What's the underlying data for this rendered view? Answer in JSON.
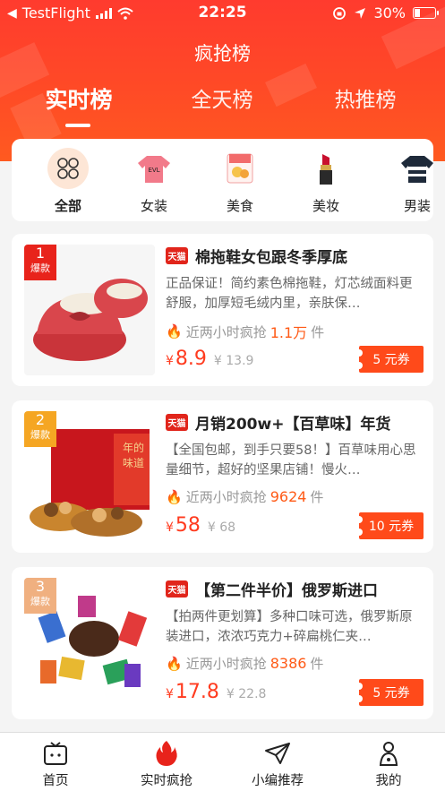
{
  "status_bar": {
    "carrier": "TestFlight",
    "time": "22:25",
    "battery": "30%",
    "battery_level": 0.3
  },
  "header": {
    "title": "疯抢榜"
  },
  "tabs": [
    {
      "label": "实时榜",
      "active": true
    },
    {
      "label": "全天榜",
      "active": false
    },
    {
      "label": "热推榜",
      "active": false
    }
  ],
  "categories": [
    {
      "label": "全部",
      "icon": "grid-icon",
      "active": true
    },
    {
      "label": "女装",
      "icon": "sweater-icon"
    },
    {
      "label": "美食",
      "icon": "snack-icon"
    },
    {
      "label": "美妆",
      "icon": "lipstick-icon"
    },
    {
      "label": "男装",
      "icon": "mens-sweater-icon"
    }
  ],
  "products": [
    {
      "rank": "1",
      "rank_tag": "爆款",
      "rank_color": "#e8231b",
      "platform": "天猫",
      "title": "棉拖鞋女包跟冬季厚底",
      "desc": "正品保证！简约素色棉拖鞋，灯芯绒面料更舒服，加厚短毛绒内里，亲肤保…",
      "hot_prefix": "近两小时疯抢",
      "hot_count": "1.1万",
      "hot_suffix": "件",
      "currency": "¥",
      "price": "8.9",
      "orig_price": "¥ 13.9",
      "coupon": "5 元券"
    },
    {
      "rank": "2",
      "rank_tag": "爆款",
      "rank_color": "#f5a623",
      "platform": "天猫",
      "title": "月销200w+【百草味】年货",
      "desc": "【全国包邮，到手只要58！】百草味用心思量细节，超好的坚果店铺！慢火…",
      "hot_prefix": "近两小时疯抢",
      "hot_count": "9624",
      "hot_suffix": "件",
      "currency": "¥",
      "price": "58",
      "orig_price": "¥ 68",
      "coupon": "10 元券"
    },
    {
      "rank": "3",
      "rank_tag": "爆款",
      "rank_color": "#f0b080",
      "platform": "天猫",
      "title": "【第二件半价】俄罗斯进口",
      "desc": "【拍两件更划算】多种口味可选，俄罗斯原装进口，浓浓巧克力+碎扁桃仁夹…",
      "hot_prefix": "近两小时疯抢",
      "hot_count": "8386",
      "hot_suffix": "件",
      "currency": "¥",
      "price": "17.8",
      "orig_price": "¥ 22.8",
      "coupon": "5 元券"
    }
  ],
  "bottom_nav": [
    {
      "label": "首页",
      "icon": "tv-home-icon"
    },
    {
      "label": "实时疯抢",
      "icon": "flame-icon"
    },
    {
      "label": "小编推荐",
      "icon": "paper-plane-icon"
    },
    {
      "label": "我的",
      "icon": "profile-icon"
    }
  ],
  "colors": {
    "accent": "#ff3b2e",
    "price": "#ff3b1f",
    "coupon": "#ff4a1a"
  }
}
